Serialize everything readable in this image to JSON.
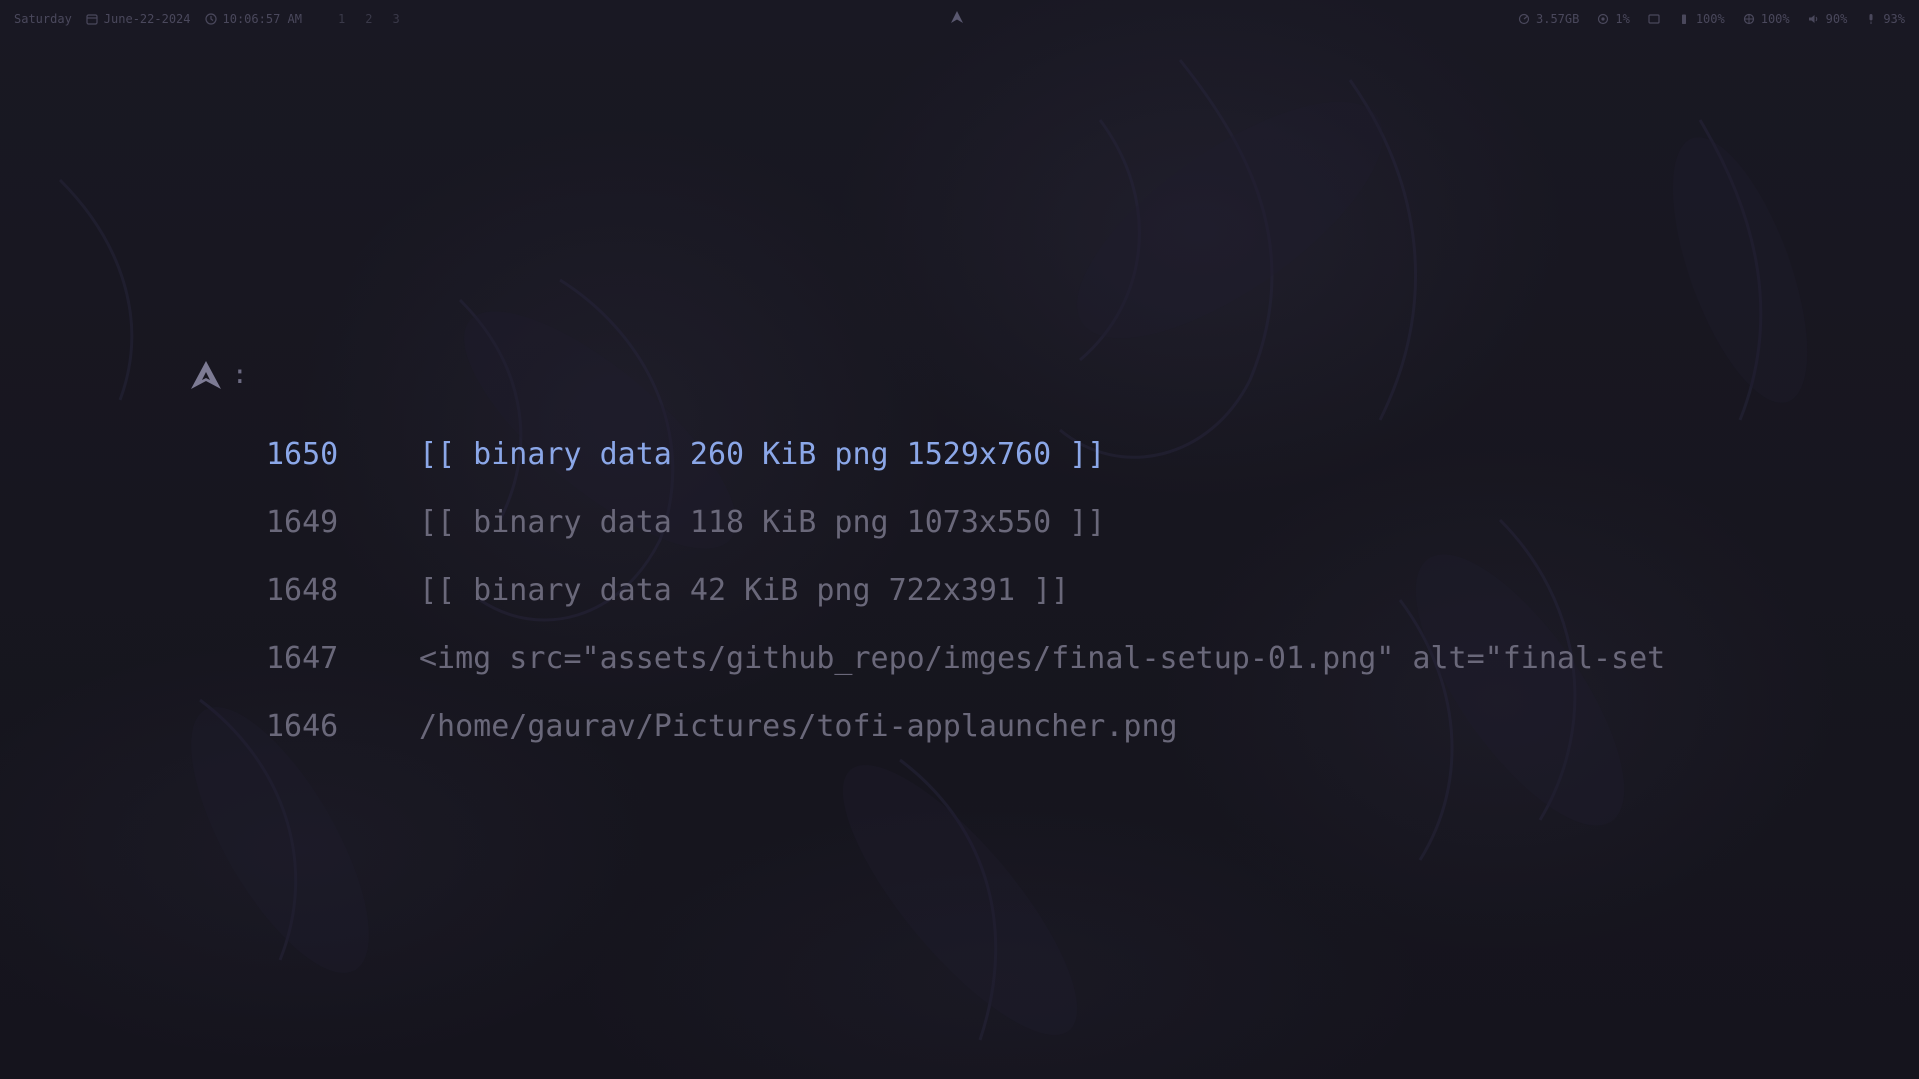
{
  "topbar": {
    "day": "Saturday",
    "date": "June-22-2024",
    "time": "10:06:57 AM",
    "workspaces": [
      "1",
      "2",
      "3"
    ],
    "memory": "3.57GB",
    "cpu": "1%",
    "brightness": "100%",
    "network": "100%",
    "volume": "90%",
    "microphone": "93%",
    "icons": {
      "calendar": "calendar-icon",
      "clock": "clock-icon",
      "arch": "arch-logo-icon",
      "memory": "memory-icon",
      "cpu": "cpu-icon",
      "display": "display-icon",
      "brightness": "battery-icon",
      "network": "network-icon",
      "volume": "volume-icon",
      "microphone": "microphone-icon"
    }
  },
  "launcher": {
    "prompt_icon": "arch-logo-icon",
    "prompt_symbol": ":",
    "input_value": "",
    "selected_index": 0,
    "items": [
      {
        "id": "1650",
        "text": "[[ binary data 260 KiB png 1529x760 ]]"
      },
      {
        "id": "1649",
        "text": "[[ binary data 118 KiB png 1073x550 ]]"
      },
      {
        "id": "1648",
        "text": "[[ binary data 42 KiB png 722x391 ]]"
      },
      {
        "id": "1647",
        "text": "<img src=\"assets/github_repo/imges/final-setup-01.png\" alt=\"final-set"
      },
      {
        "id": "1646",
        "text": "/home/gaurav/Pictures/tofi-applauncher.png"
      }
    ]
  },
  "colors": {
    "background": "#16151f",
    "selected": "#8ba7e8",
    "item": "#6a687a",
    "topbar_text": "#4a485c"
  }
}
